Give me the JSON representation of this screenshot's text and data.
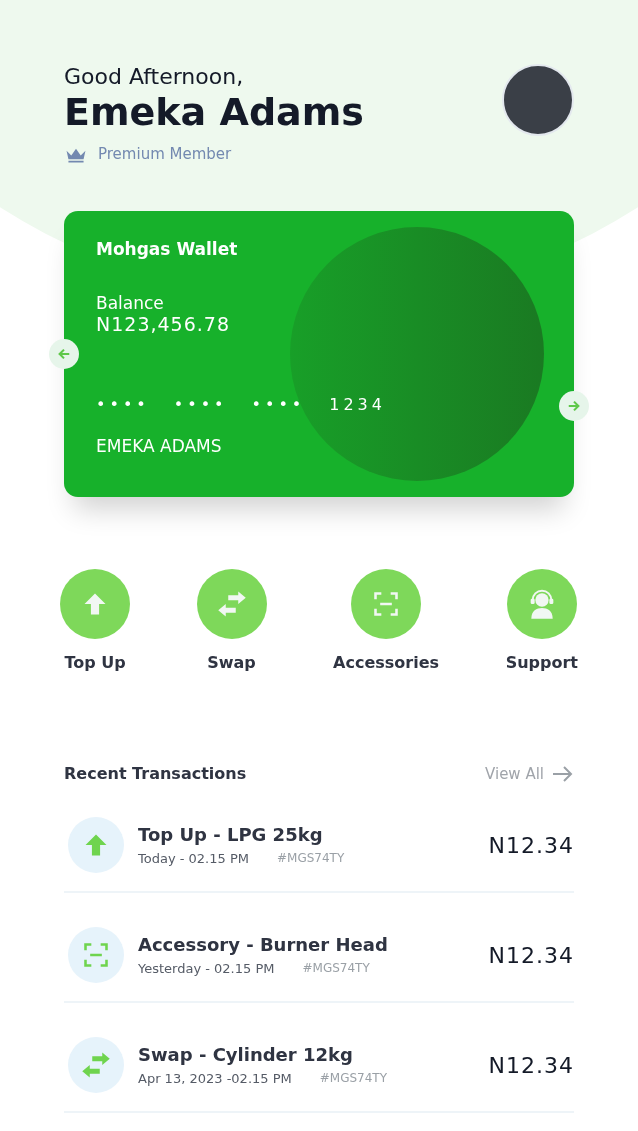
{
  "header": {
    "greeting": "Good Afternoon,",
    "name": "Emeka Adams",
    "membership": "Premium Member"
  },
  "wallet_card": {
    "title": "Mohgas Wallet",
    "balance_label": "Balance",
    "balance": "N123,456.78",
    "card_number_groups": [
      "••••",
      "••••",
      "••••",
      "1234"
    ],
    "holder": "EMEKA ADAMS"
  },
  "actions": [
    {
      "kind": "up",
      "label": "Top Up"
    },
    {
      "kind": "swap",
      "label": "Swap"
    },
    {
      "kind": "scan",
      "label": "Accessories"
    },
    {
      "kind": "support",
      "label": "Support"
    }
  ],
  "recent_transactions": {
    "title": "Recent Transactions",
    "view_all": "View All",
    "items": [
      {
        "kind": "up",
        "title": "Top Up - LPG 25kg",
        "time": "Today - 02.15 PM",
        "ref": "#MGS74TY",
        "amount": "N12.34"
      },
      {
        "kind": "scan",
        "title": "Accessory - Burner Head",
        "time": "Yesterday - 02.15 PM",
        "ref": "#MGS74TY",
        "amount": "N12.34"
      },
      {
        "kind": "swap",
        "title": "Swap - Cylinder 12kg",
        "time": "Apr 13, 2023 -02.15 PM",
        "ref": "#MGS74TY",
        "amount": "N12.34"
      }
    ]
  }
}
